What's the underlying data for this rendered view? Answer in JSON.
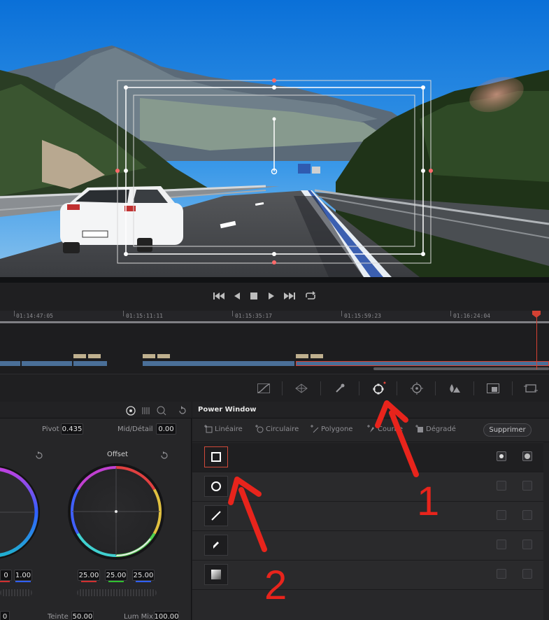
{
  "transport": {
    "buttons": [
      "skip-back-icon",
      "play-reverse-icon",
      "stop-icon",
      "play-icon",
      "skip-forward-icon",
      "loop-icon"
    ]
  },
  "timeline": {
    "timecodes": [
      "01:14:47:05",
      "01:15:11:11",
      "01:15:35:17",
      "01:15:59:23",
      "01:16:24:04"
    ]
  },
  "toolbar": {
    "tools": [
      "curves-icon",
      "warper-icon",
      "qualifier-icon",
      "power-window-icon",
      "tracker-icon",
      "magic-mask-icon",
      "blur-icon",
      "key-icon",
      "sizing-icon"
    ],
    "active_tool": "power-window-icon"
  },
  "left_panel": {
    "pivot_label": "Pivot",
    "pivot_value": "0.435",
    "middetail_label": "Mid/Détail",
    "middetail_value": "0.00",
    "offset_label": "Offset",
    "left_wheel_values": [
      "0",
      "1.00"
    ],
    "offset_values": [
      "25.00",
      "25.00",
      "25.00"
    ],
    "teinte_label": "Teinte",
    "teinte_value": "50.00",
    "lummix_label": "Lum Mix",
    "lummix_value": "100.00",
    "bottom_left_value": "0"
  },
  "power_window": {
    "title": "Power Window",
    "shapes": [
      {
        "label": "Linéaire",
        "icon": "linear-icon"
      },
      {
        "label": "Circulaire",
        "icon": "circular-icon"
      },
      {
        "label": "Polygone",
        "icon": "polygon-icon"
      },
      {
        "label": "Courbe",
        "icon": "curve-icon"
      },
      {
        "label": "Dégradé",
        "icon": "gradient-icon"
      }
    ],
    "delete_label": "Supprimer",
    "rows": [
      {
        "icon": "square-window-icon",
        "active": true
      },
      {
        "icon": "circle-window-icon",
        "active": false
      },
      {
        "icon": "line-window-icon",
        "active": false
      },
      {
        "icon": "pen-window-icon",
        "active": false
      },
      {
        "icon": "gradient-window-icon",
        "active": false
      }
    ]
  },
  "annotations": {
    "label_1": "1",
    "label_2": "2",
    "color": "#e8241c"
  }
}
